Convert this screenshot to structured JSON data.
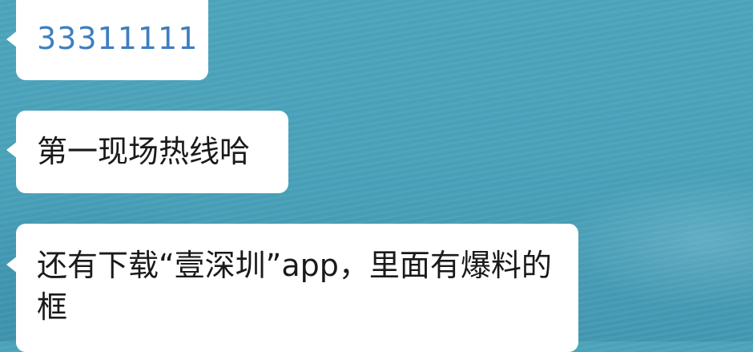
{
  "messages": [
    {
      "text": "33311111",
      "link": true
    },
    {
      "text": "第一现场热线哈",
      "link": false
    },
    {
      "text": "还有下载“壹深圳”app，里面有爆料的框",
      "link": false
    }
  ],
  "colors": {
    "background": "#4aa3bb",
    "bubble": "#ffffff",
    "link_text": "#3d7fc1",
    "message_text": "#1a1a1a"
  }
}
